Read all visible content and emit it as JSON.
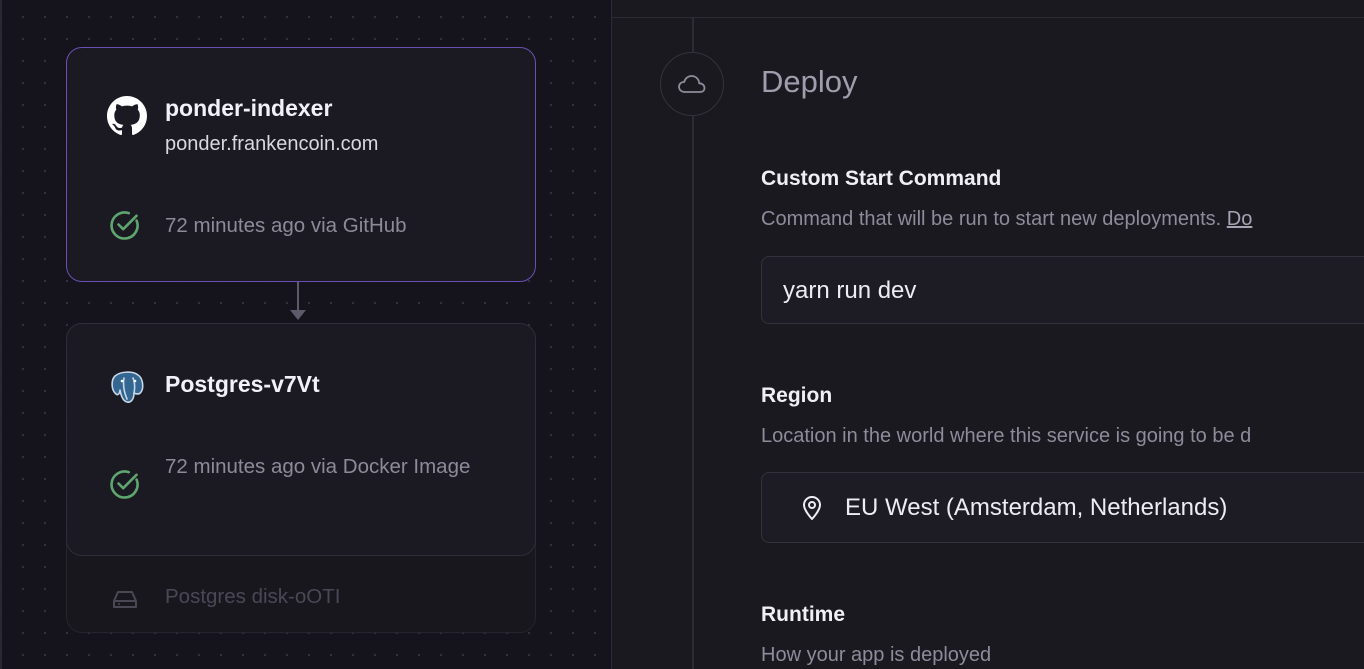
{
  "canvas": {
    "services": [
      {
        "name": "ponder-indexer",
        "domain": "ponder.frankencoin.com",
        "status": "72 minutes ago via GitHub",
        "icon": "github-icon",
        "selected": true
      },
      {
        "name": "Postgres-v7Vt",
        "status": "72 minutes ago via Docker Image",
        "icon": "postgres-icon",
        "selected": false
      }
    ],
    "volume": {
      "name": "Postgres disk-oOTI",
      "icon": "hard-drive-icon"
    }
  },
  "panel": {
    "section": {
      "title": "Deploy",
      "icon": "cloud-icon"
    },
    "start_command": {
      "label": "Custom Start Command",
      "description": "Command that will be run to start new deployments.",
      "link": "Do",
      "value": "yarn run dev"
    },
    "region": {
      "label": "Region",
      "description": "Location in the world where this service is going to be d",
      "value": "EU West (Amsterdam, Netherlands)",
      "icon": "map-pin-icon"
    },
    "runtime": {
      "label": "Runtime",
      "description": "How your app is deployed"
    }
  },
  "colors": {
    "selected_border": "#6a4fb4",
    "success": "#5fa56f",
    "background": "#131219"
  }
}
